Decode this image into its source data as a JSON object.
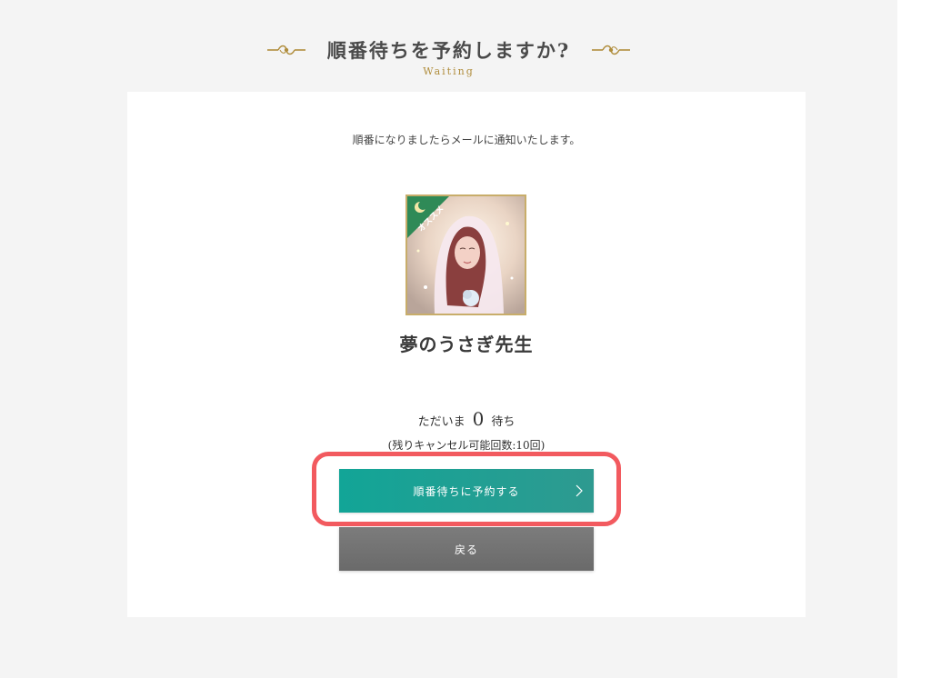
{
  "header": {
    "title": "順番待ちを予約しますか?",
    "subtitle": "Waiting"
  },
  "card": {
    "notice": "順番になりましたらメールに通知いたします。",
    "avatar": {
      "badge_text": "オススメ",
      "badge_icon": "moon-icon"
    },
    "teacher_name": "夢のうさぎ先生",
    "wait": {
      "prefix": "ただいま",
      "count": "0",
      "suffix": "待ち"
    },
    "cancel_info": "(残りキャンセル可能回数:10回)",
    "reserve_button": "順番待ちに予約する",
    "back_button": "戻る"
  },
  "colors": {
    "accent_teal": "#12a597",
    "highlight_red": "#f25a5f",
    "gold": "#c8ad6a",
    "badge_green": "#2f8a57"
  }
}
